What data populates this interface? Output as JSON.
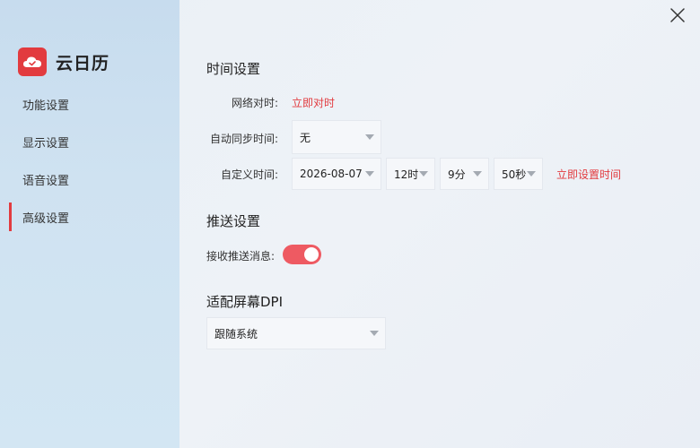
{
  "app": {
    "name": "云日历",
    "accent_color": "#e23b3f"
  },
  "sidebar": {
    "items": [
      {
        "label": "功能设置",
        "active": false
      },
      {
        "label": "显示设置",
        "active": false
      },
      {
        "label": "语音设置",
        "active": false
      },
      {
        "label": "高级设置",
        "active": true
      }
    ]
  },
  "time_settings": {
    "title": "时间设置",
    "network_sync": {
      "label": "网络对时:",
      "action": "立即对时"
    },
    "auto_sync": {
      "label": "自动同步时间:",
      "value": "无"
    },
    "custom_time": {
      "label": "自定义时间:",
      "date": "2026-08-07",
      "hour": "12时",
      "minute": "9分",
      "second": "50秒",
      "action": "立即设置时间"
    }
  },
  "push_settings": {
    "title": "推送设置",
    "receive_label": "接收推送消息:",
    "receive_enabled": true
  },
  "dpi_settings": {
    "title": "适配屏幕DPI",
    "value": "跟随系统"
  },
  "icons": {
    "close": "close-icon",
    "logo": "cloud-calendar-logo-icon",
    "dropdown": "chevron-down-icon"
  }
}
